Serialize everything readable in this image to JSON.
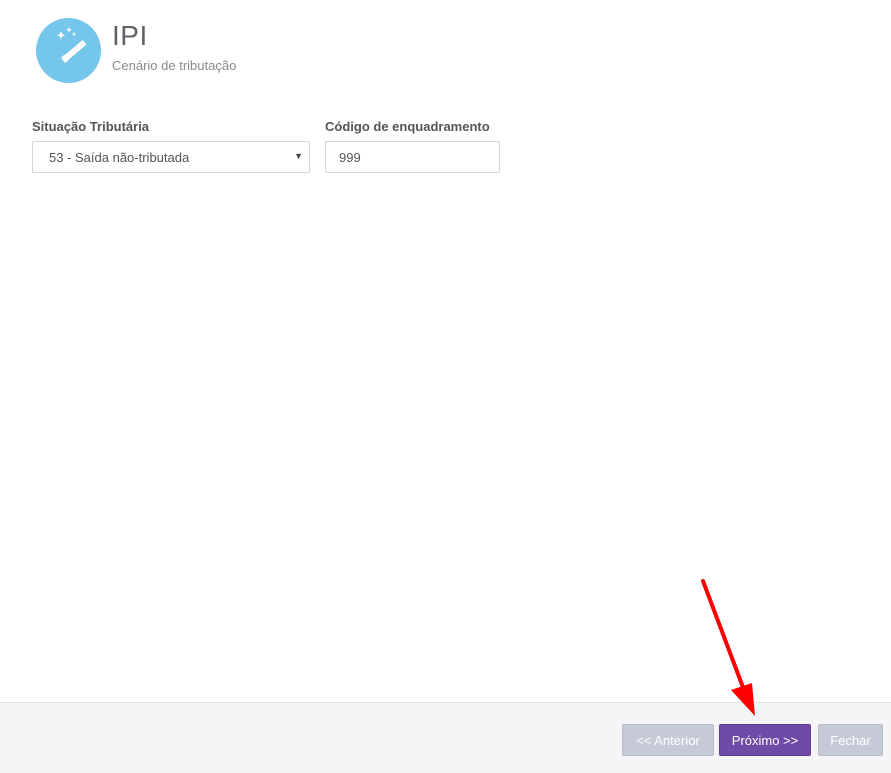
{
  "header": {
    "title": "IPI",
    "subtitle": "Cenário de tributação",
    "icon": "magic-wand-icon",
    "icon_bg_color": "#74c6ea"
  },
  "form": {
    "situacao_tributaria": {
      "label": "Situação Tributária",
      "selected_value": "53 - Saída não-tributada"
    },
    "codigo_enquadramento": {
      "label": "Código de enquadramento",
      "value": "999"
    }
  },
  "footer": {
    "anterior_label": "<< Anterior",
    "proximo_label": "Próximo >>",
    "fechar_label": "Fechar",
    "primary_color": "#6f4aa6",
    "disabled_color": "#c6cad6"
  },
  "annotation": {
    "arrow_color": "#ff0000",
    "arrow_target": "next-button"
  }
}
